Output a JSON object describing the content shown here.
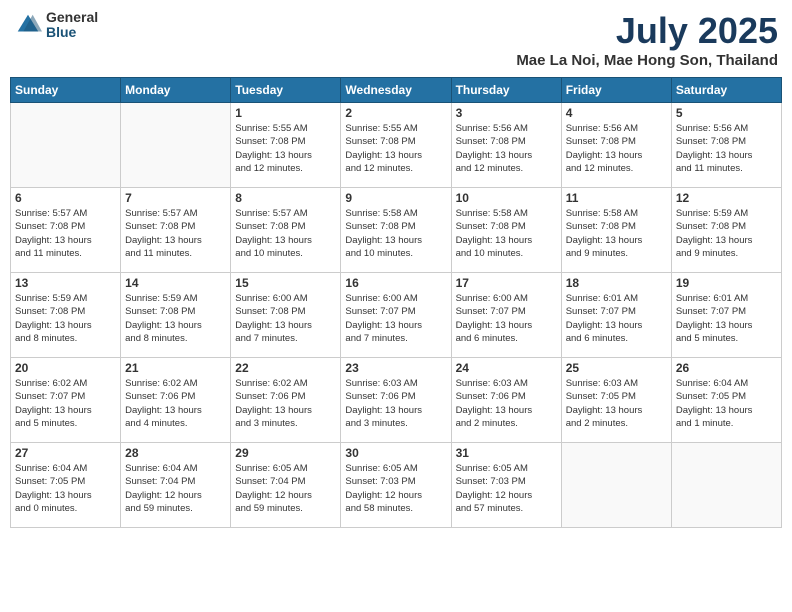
{
  "logo": {
    "general": "General",
    "blue": "Blue"
  },
  "header": {
    "month": "July 2025",
    "location": "Mae La Noi, Mae Hong Son, Thailand"
  },
  "weekdays": [
    "Sunday",
    "Monday",
    "Tuesday",
    "Wednesday",
    "Thursday",
    "Friday",
    "Saturday"
  ],
  "weeks": [
    [
      {
        "day": "",
        "detail": ""
      },
      {
        "day": "",
        "detail": ""
      },
      {
        "day": "1",
        "detail": "Sunrise: 5:55 AM\nSunset: 7:08 PM\nDaylight: 13 hours\nand 12 minutes."
      },
      {
        "day": "2",
        "detail": "Sunrise: 5:55 AM\nSunset: 7:08 PM\nDaylight: 13 hours\nand 12 minutes."
      },
      {
        "day": "3",
        "detail": "Sunrise: 5:56 AM\nSunset: 7:08 PM\nDaylight: 13 hours\nand 12 minutes."
      },
      {
        "day": "4",
        "detail": "Sunrise: 5:56 AM\nSunset: 7:08 PM\nDaylight: 13 hours\nand 12 minutes."
      },
      {
        "day": "5",
        "detail": "Sunrise: 5:56 AM\nSunset: 7:08 PM\nDaylight: 13 hours\nand 11 minutes."
      }
    ],
    [
      {
        "day": "6",
        "detail": "Sunrise: 5:57 AM\nSunset: 7:08 PM\nDaylight: 13 hours\nand 11 minutes."
      },
      {
        "day": "7",
        "detail": "Sunrise: 5:57 AM\nSunset: 7:08 PM\nDaylight: 13 hours\nand 11 minutes."
      },
      {
        "day": "8",
        "detail": "Sunrise: 5:57 AM\nSunset: 7:08 PM\nDaylight: 13 hours\nand 10 minutes."
      },
      {
        "day": "9",
        "detail": "Sunrise: 5:58 AM\nSunset: 7:08 PM\nDaylight: 13 hours\nand 10 minutes."
      },
      {
        "day": "10",
        "detail": "Sunrise: 5:58 AM\nSunset: 7:08 PM\nDaylight: 13 hours\nand 10 minutes."
      },
      {
        "day": "11",
        "detail": "Sunrise: 5:58 AM\nSunset: 7:08 PM\nDaylight: 13 hours\nand 9 minutes."
      },
      {
        "day": "12",
        "detail": "Sunrise: 5:59 AM\nSunset: 7:08 PM\nDaylight: 13 hours\nand 9 minutes."
      }
    ],
    [
      {
        "day": "13",
        "detail": "Sunrise: 5:59 AM\nSunset: 7:08 PM\nDaylight: 13 hours\nand 8 minutes."
      },
      {
        "day": "14",
        "detail": "Sunrise: 5:59 AM\nSunset: 7:08 PM\nDaylight: 13 hours\nand 8 minutes."
      },
      {
        "day": "15",
        "detail": "Sunrise: 6:00 AM\nSunset: 7:08 PM\nDaylight: 13 hours\nand 7 minutes."
      },
      {
        "day": "16",
        "detail": "Sunrise: 6:00 AM\nSunset: 7:07 PM\nDaylight: 13 hours\nand 7 minutes."
      },
      {
        "day": "17",
        "detail": "Sunrise: 6:00 AM\nSunset: 7:07 PM\nDaylight: 13 hours\nand 6 minutes."
      },
      {
        "day": "18",
        "detail": "Sunrise: 6:01 AM\nSunset: 7:07 PM\nDaylight: 13 hours\nand 6 minutes."
      },
      {
        "day": "19",
        "detail": "Sunrise: 6:01 AM\nSunset: 7:07 PM\nDaylight: 13 hours\nand 5 minutes."
      }
    ],
    [
      {
        "day": "20",
        "detail": "Sunrise: 6:02 AM\nSunset: 7:07 PM\nDaylight: 13 hours\nand 5 minutes."
      },
      {
        "day": "21",
        "detail": "Sunrise: 6:02 AM\nSunset: 7:06 PM\nDaylight: 13 hours\nand 4 minutes."
      },
      {
        "day": "22",
        "detail": "Sunrise: 6:02 AM\nSunset: 7:06 PM\nDaylight: 13 hours\nand 3 minutes."
      },
      {
        "day": "23",
        "detail": "Sunrise: 6:03 AM\nSunset: 7:06 PM\nDaylight: 13 hours\nand 3 minutes."
      },
      {
        "day": "24",
        "detail": "Sunrise: 6:03 AM\nSunset: 7:06 PM\nDaylight: 13 hours\nand 2 minutes."
      },
      {
        "day": "25",
        "detail": "Sunrise: 6:03 AM\nSunset: 7:05 PM\nDaylight: 13 hours\nand 2 minutes."
      },
      {
        "day": "26",
        "detail": "Sunrise: 6:04 AM\nSunset: 7:05 PM\nDaylight: 13 hours\nand 1 minute."
      }
    ],
    [
      {
        "day": "27",
        "detail": "Sunrise: 6:04 AM\nSunset: 7:05 PM\nDaylight: 13 hours\nand 0 minutes."
      },
      {
        "day": "28",
        "detail": "Sunrise: 6:04 AM\nSunset: 7:04 PM\nDaylight: 12 hours\nand 59 minutes."
      },
      {
        "day": "29",
        "detail": "Sunrise: 6:05 AM\nSunset: 7:04 PM\nDaylight: 12 hours\nand 59 minutes."
      },
      {
        "day": "30",
        "detail": "Sunrise: 6:05 AM\nSunset: 7:03 PM\nDaylight: 12 hours\nand 58 minutes."
      },
      {
        "day": "31",
        "detail": "Sunrise: 6:05 AM\nSunset: 7:03 PM\nDaylight: 12 hours\nand 57 minutes."
      },
      {
        "day": "",
        "detail": ""
      },
      {
        "day": "",
        "detail": ""
      }
    ]
  ]
}
